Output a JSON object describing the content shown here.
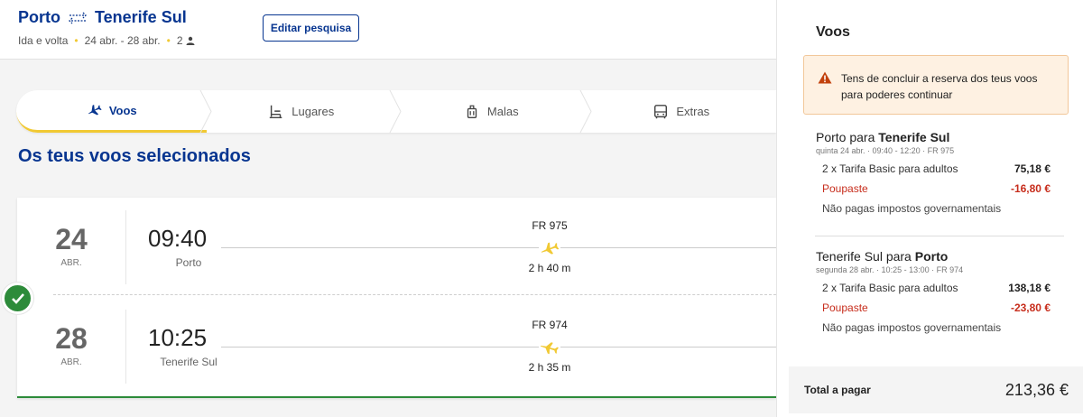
{
  "header": {
    "origin": "Porto",
    "destination": "Tenerife Sul",
    "trip_type": "Ida e volta",
    "dates": "24 abr. - 28 abr.",
    "passengers": "2",
    "edit_label": "Editar pesquisa"
  },
  "steps": [
    {
      "label": "Voos",
      "icon": "plane-icon",
      "active": true
    },
    {
      "label": "Lugares",
      "icon": "seat-icon",
      "active": false
    },
    {
      "label": "Malas",
      "icon": "bag-icon",
      "active": false
    },
    {
      "label": "Extras",
      "icon": "bus-icon",
      "active": false
    }
  ],
  "section_title": "Os teus voos selecionados",
  "flights": [
    {
      "day": "24",
      "month": "ABR.",
      "time": "09:40",
      "city": "Porto",
      "flight_no": "FR 975",
      "duration": "2 h 40 m"
    },
    {
      "day": "28",
      "month": "ABR.",
      "time": "10:25",
      "city": "Tenerife Sul",
      "flight_no": "FR 974",
      "duration": "2 h 35 m"
    }
  ],
  "summary": {
    "title": "Voos",
    "warning": "Tens de concluir a reserva dos teus voos para poderes continuar",
    "legs": [
      {
        "from": "Porto para ",
        "to": "Tenerife Sul",
        "details": "quinta 24 abr. · 09:40 - 12:20 · FR 975",
        "fare_label": "2 x Tarifa Basic para adultos",
        "fare_value": "75,18 €",
        "saved_label": "Poupaste",
        "saved_value": "-16,80 €",
        "tax_label": "Não pagas impostos governamentais"
      },
      {
        "from": "Tenerife Sul para ",
        "to": "Porto",
        "details": "segunda 28 abr. · 10:25 - 13:00 · FR 974",
        "fare_label": "2 x Tarifa Basic para adultos",
        "fare_value": "138,18 €",
        "saved_label": "Poupaste",
        "saved_value": "-23,80 €",
        "tax_label": "Não pagas impostos governamentais"
      }
    ],
    "total_label": "Total a pagar",
    "total_value": "213,36 €"
  },
  "colors": {
    "brand_blue": "#073590",
    "accent_yellow": "#f1c933",
    "success_green": "#2d8b3a",
    "saved_red": "#c72d1c",
    "warning_bg": "#fef1e2"
  }
}
